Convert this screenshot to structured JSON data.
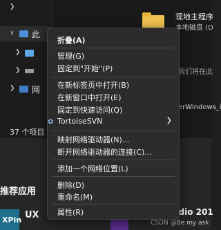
{
  "navigation": {
    "selected_item": "此",
    "extra_item": "网",
    "item_count": "37 个项目"
  },
  "drive": {
    "name": "现地主程序",
    "subtitle": "本地磁盘 (D"
  },
  "background_text": {
    "line1": "我们将在此",
    "line2": "erWindows_i"
  },
  "start_menu": {
    "section_title": "推荐应用",
    "app1_tile": "XPin",
    "app1_name": "UX",
    "app2_name": "udio 201"
  },
  "watermark": "CSDN @Be my ask",
  "context_menu": {
    "items": [
      {
        "label": "折叠(A)"
      },
      {
        "label": "管理(G)"
      },
      {
        "label": "固定到\"开始\"(P)"
      },
      {
        "label": "在新标签页中打开(B)"
      },
      {
        "label": "在新窗口中打开(E)"
      },
      {
        "label": "固定到快速访问(Q)"
      },
      {
        "label": "TortoiseSVN"
      },
      {
        "label": "映射网络驱动器(N)..."
      },
      {
        "label": "断开网络驱动器的连接(C)..."
      },
      {
        "label": "添加一个网络位置(L)"
      },
      {
        "label": "删除(D)"
      },
      {
        "label": "重命名(M)"
      },
      {
        "label": "属性(R)"
      }
    ]
  },
  "icons": {
    "submenu": "chevron-right-icon",
    "svn": "tortoisesvn-icon",
    "folder": "folder-icon"
  }
}
